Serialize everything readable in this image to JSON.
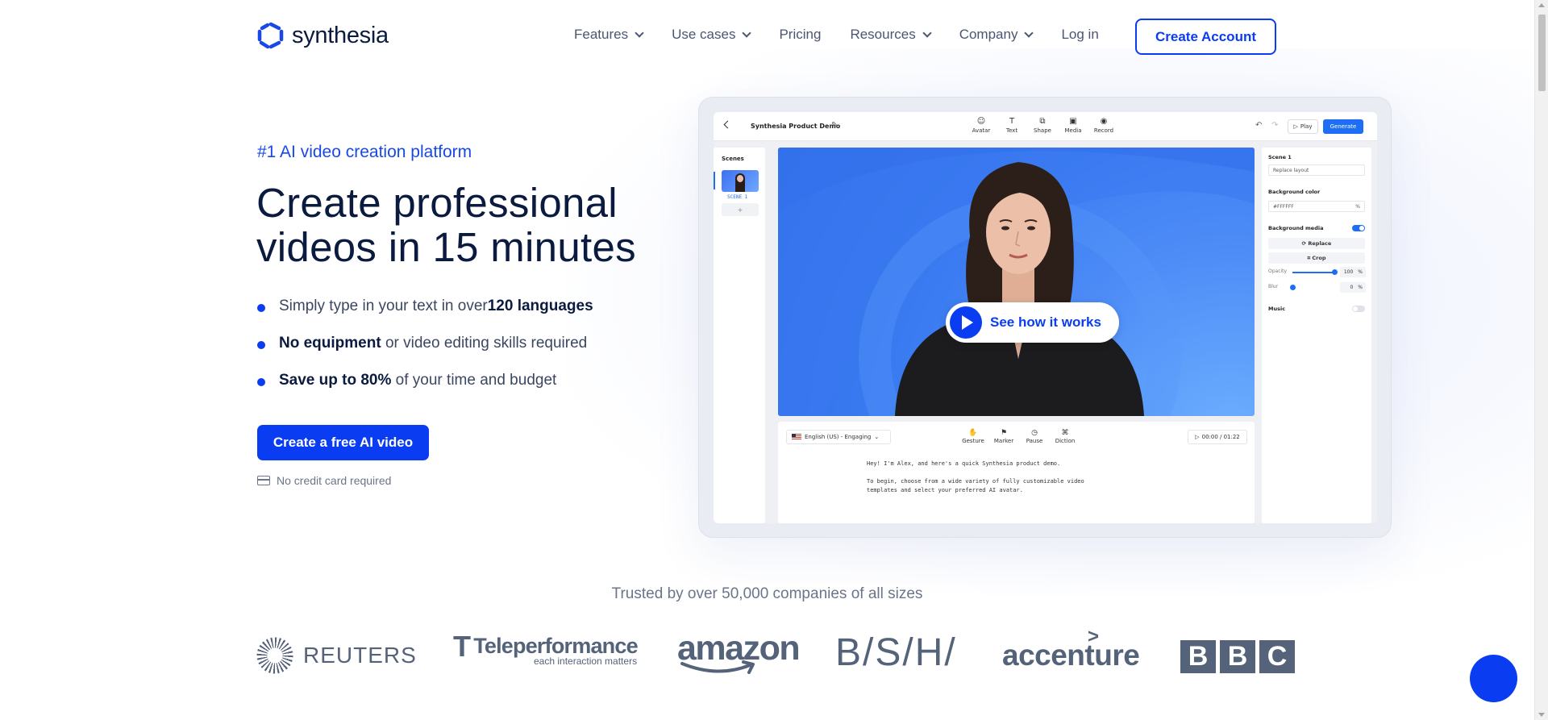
{
  "header": {
    "logo_text": "synthesia",
    "nav": [
      {
        "label": "Features",
        "dropdown": true
      },
      {
        "label": "Use cases",
        "dropdown": true
      },
      {
        "label": "Pricing",
        "dropdown": false
      },
      {
        "label": "Resources",
        "dropdown": true
      },
      {
        "label": "Company",
        "dropdown": true
      },
      {
        "label": "Log in",
        "dropdown": false
      }
    ],
    "create_account": "Create Account"
  },
  "hero": {
    "eyebrow": "#1 AI video creation platform",
    "headline": "Create professional videos in 15 minutes",
    "bullets": [
      {
        "pre": "Simply type in your text in over ",
        "bold": "120 languages",
        "post": ""
      },
      {
        "pre": "",
        "bold": "No equipment",
        "post": " or video editing skills required"
      },
      {
        "pre": "",
        "bold": "Save up to 80%",
        "post": " of your time and budget"
      }
    ],
    "cta": "Create a free AI video",
    "no_credit_card": "No credit card required"
  },
  "app": {
    "project_title": "Synthesia Product Demo",
    "toolbar": [
      "Avatar",
      "Text",
      "Shape",
      "Media",
      "Record"
    ],
    "toolbar_icons": [
      "avatar-icon",
      "text-icon",
      "shape-icon",
      "media-icon",
      "record-icon"
    ],
    "play": "Play",
    "generate": "Generate",
    "scenes_title": "Scenes",
    "scene_label": "SCENE 1",
    "add_scene": "+",
    "see_how": "See how it works",
    "language": "English (US) - Engaging",
    "script_tools": [
      "Gesture",
      "Marker",
      "Pause",
      "Diction"
    ],
    "timecode": "00:00 / 01:22",
    "script_lines": [
      "Hey! I'm Alex, and here's a quick Synthesia product demo.",
      "To begin, choose from a wide variety of fully customizable video templates and select your preferred AI avatar."
    ],
    "props": {
      "scene": "Scene 1",
      "layout": "Replace layout",
      "bg_color_title": "Background color",
      "bg_color_value": "#FFFFFF",
      "bg_color_pct": "%",
      "bg_media_title": "Background media",
      "replace": "Replace",
      "crop": "Crop",
      "opacity_label": "Opacity",
      "opacity_value": "100",
      "opacity_fraction": 1.0,
      "blur_label": "Blur",
      "blur_value": "0",
      "blur_fraction": 0.0,
      "unit": "%",
      "music": "Music"
    }
  },
  "trusted": {
    "text": "Trusted by over 50,000 companies of all sizes",
    "logos": {
      "reuters": "REUTERS",
      "teleperformance": "Teleperformance",
      "teleperformance_tagline": "each interaction matters",
      "amazon": "amazon",
      "bsh": "B/S/H/",
      "accenture": "accenture",
      "bbc": [
        "B",
        "B",
        "C"
      ]
    }
  },
  "colors": {
    "brand_blue": "#0a3df2",
    "heading": "#0b1b3f",
    "logo_gray": "#55637a"
  }
}
